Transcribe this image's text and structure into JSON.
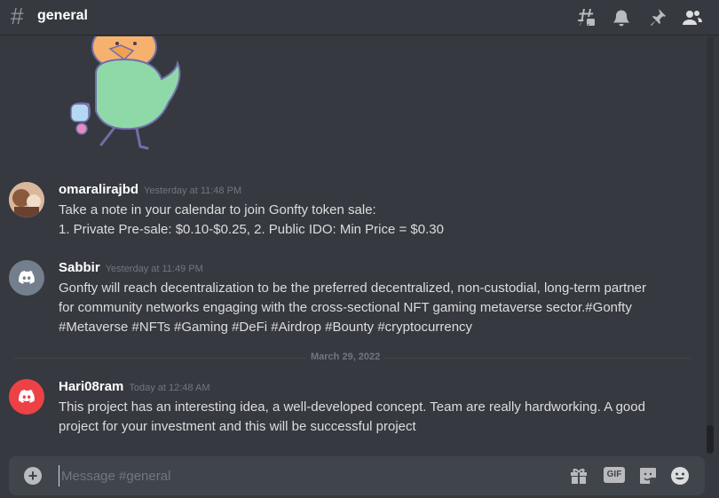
{
  "header": {
    "hash": "#",
    "channel_name": "general"
  },
  "messages": [
    {
      "username": "omaralirajbd",
      "timestamp": "Yesterday at 11:48 PM",
      "lines": [
        "Take a note in your calendar to join Gonfty token sale:",
        "1. Private Pre-sale: $0.10-$0.25, 2. Public IDO: Min Price = $0.30"
      ]
    },
    {
      "username": "Sabbir",
      "timestamp": "Yesterday at 11:49 PM",
      "lines": [
        "Gonfty will reach decentralization to be the preferred decentralized, non-custodial, long-term partner",
        "for community networks engaging with the cross-sectional NFT gaming metaverse sector.#Gonfty",
        "#Metaverse #NFTs #Gaming #DeFi #Airdrop #Bounty #cryptocurrency"
      ]
    },
    {
      "username": "Hari08ram",
      "timestamp": "Today at 12:48 AM",
      "lines": [
        "This project has an interesting idea, a well-developed concept. Team are really hardworking. A good",
        "project for your investment and this will be successful project"
      ]
    }
  ],
  "divider": {
    "date": "March 29, 2022"
  },
  "composer": {
    "add_symbol": "+",
    "placeholder": "Message #general",
    "gif_label": "GIF"
  },
  "colors": {
    "background": "#36393f",
    "composer": "#40444b",
    "discord_gray_avatar": "#747f8d",
    "discord_red_avatar": "#ed4245",
    "sticker_body": "#8fd9a8",
    "sticker_head": "#f6b16f"
  },
  "icons": [
    "hashtag-threads-icon",
    "bell-icon",
    "pin-icon",
    "members-icon",
    "gift-icon",
    "sticker-icon",
    "emoji-icon",
    "discord-logo-icon"
  ]
}
